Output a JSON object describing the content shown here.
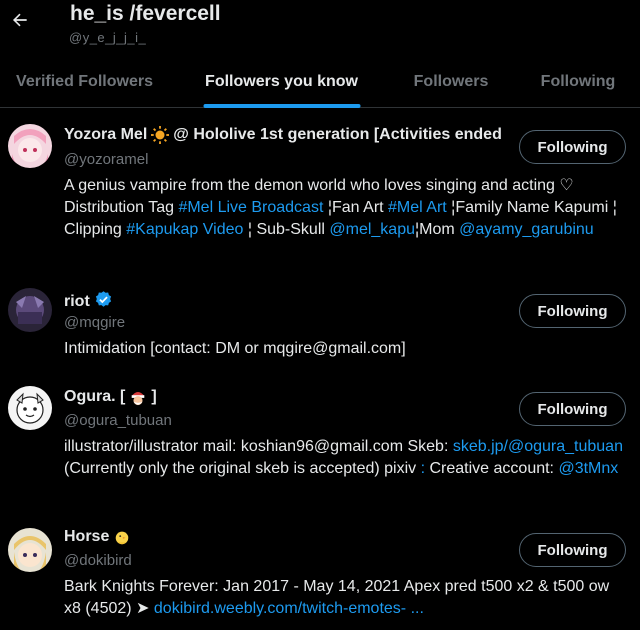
{
  "header": {
    "title": "he_is /fevercell",
    "handle": "@y_e_j_j_i_"
  },
  "tabs": [
    {
      "label": "Verified Followers"
    },
    {
      "label": "Followers you know"
    },
    {
      "label": "Followers"
    },
    {
      "label": "Following"
    }
  ],
  "active_tab": "Followers you know",
  "colors": {
    "accent": "#1d9bf0",
    "muted": "#71767b",
    "text": "#e7e9ea",
    "border": "#2f3336"
  },
  "users": [
    {
      "name_a": "Yozora Mel",
      "name_emoji": "sun",
      "name_b": "@ Hololive 1st generation [Activities ended",
      "handle": "@yozoramel",
      "button": "Following",
      "bio": [
        {
          "t": "A genius vampire from the demon world who loves singing and acting ♡",
          "l": false
        },
        {
          "t": "Distribution Tag ",
          "l": false
        },
        {
          "t": "#Mel Live Broadcast",
          "l": true
        },
        {
          "t": " ¦Fan Art ",
          "l": false
        },
        {
          "t": "#Mel Art",
          "l": true
        },
        {
          "t": " ¦Family Name Kapumi ¦ Clipping ",
          "l": false
        },
        {
          "t": "#Kapukap Video",
          "l": true
        },
        {
          "t": " ¦ Sub-Skull ",
          "l": false
        },
        {
          "t": "@mel_kapu",
          "l": true
        },
        {
          "t": "¦Mom ",
          "l": false
        },
        {
          "t": "@ayamy_garubinu",
          "l": true
        }
      ]
    },
    {
      "name_a": "riot",
      "name_emoji": "verified",
      "name_b": "",
      "handle": "@mqgire",
      "button": "Following",
      "bio": [
        {
          "t": "Intimidation [contact: DM or mqgire@gmail.com]",
          "l": false
        }
      ]
    },
    {
      "name_a": "Ogura. [",
      "name_emoji": "santa",
      "name_b": "]",
      "handle": "@ogura_tubuan",
      "button": "Following",
      "bio": [
        {
          "t": "illustrator/illustrator mail: koshian96@gmail.com Skeb: ",
          "l": false
        },
        {
          "t": "skeb.jp/@ogura_tubuan",
          "l": true
        },
        {
          "t": " (Currently only the original skeb is accepted) pixiv",
          "l": false
        },
        {
          "t": " :",
          "l": true
        },
        {
          "t": " Creative account: ",
          "l": false
        },
        {
          "t": "@3tMnx",
          "l": true
        }
      ]
    },
    {
      "name_a": "Horse",
      "name_emoji": "chick",
      "name_b": "",
      "handle": "@dokibird",
      "button": "Following",
      "bio": [
        {
          "t": "Bark Knights Forever: Jan 2017 - May 14, 2021 Apex pred t500 x2 & t500 ow x8 (4502) ➤ ",
          "l": false
        },
        {
          "t": "dokibird.weebly.com/twitch-emotes- ...",
          "l": true
        }
      ]
    }
  ]
}
